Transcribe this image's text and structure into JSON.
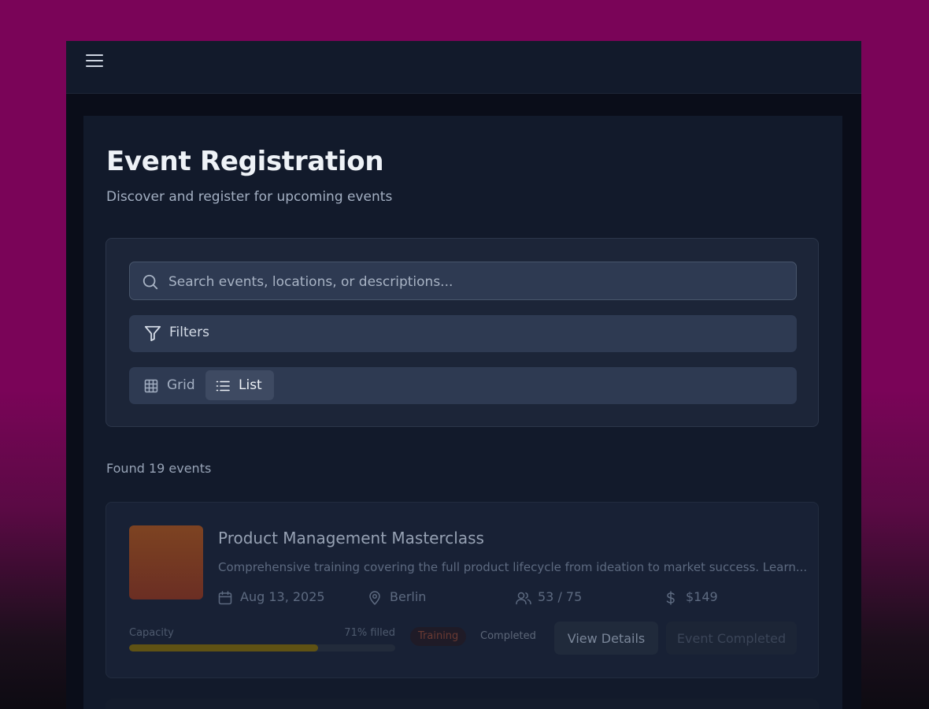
{
  "page": {
    "title": "Event Registration",
    "subtitle": "Discover and register for upcoming events"
  },
  "search": {
    "placeholder": "Search events, locations, or descriptions..."
  },
  "filters": {
    "label": "Filters"
  },
  "view_toggle": {
    "grid_label": "Grid",
    "list_label": "List",
    "active": "List"
  },
  "results": {
    "found_text": "Found 19 events"
  },
  "events": [
    {
      "title": "Product Management Masterclass",
      "description": "Comprehensive training covering the full product lifecycle from ideation to market success. Learn...",
      "date": "Aug 13, 2025",
      "location": "Berlin",
      "attendance": "53 / 75",
      "price": "$149",
      "capacity_label": "Capacity",
      "capacity_pct_text": "71% filled",
      "capacity_fraction": 0.71,
      "category": "Training",
      "status": "Completed",
      "details_button": "View Details",
      "action_button": "Event Completed"
    }
  ],
  "colors": {
    "background_magenta": "#7a0458",
    "panel": "#121a2b",
    "card": "#182135",
    "capacity_bar": "#5f5214",
    "thumbnail": "#7d4322"
  },
  "icons": [
    "menu-icon",
    "search-icon",
    "filter-icon",
    "grid-icon",
    "list-icon",
    "calendar-icon",
    "map-pin-icon",
    "users-icon",
    "dollar-icon"
  ]
}
